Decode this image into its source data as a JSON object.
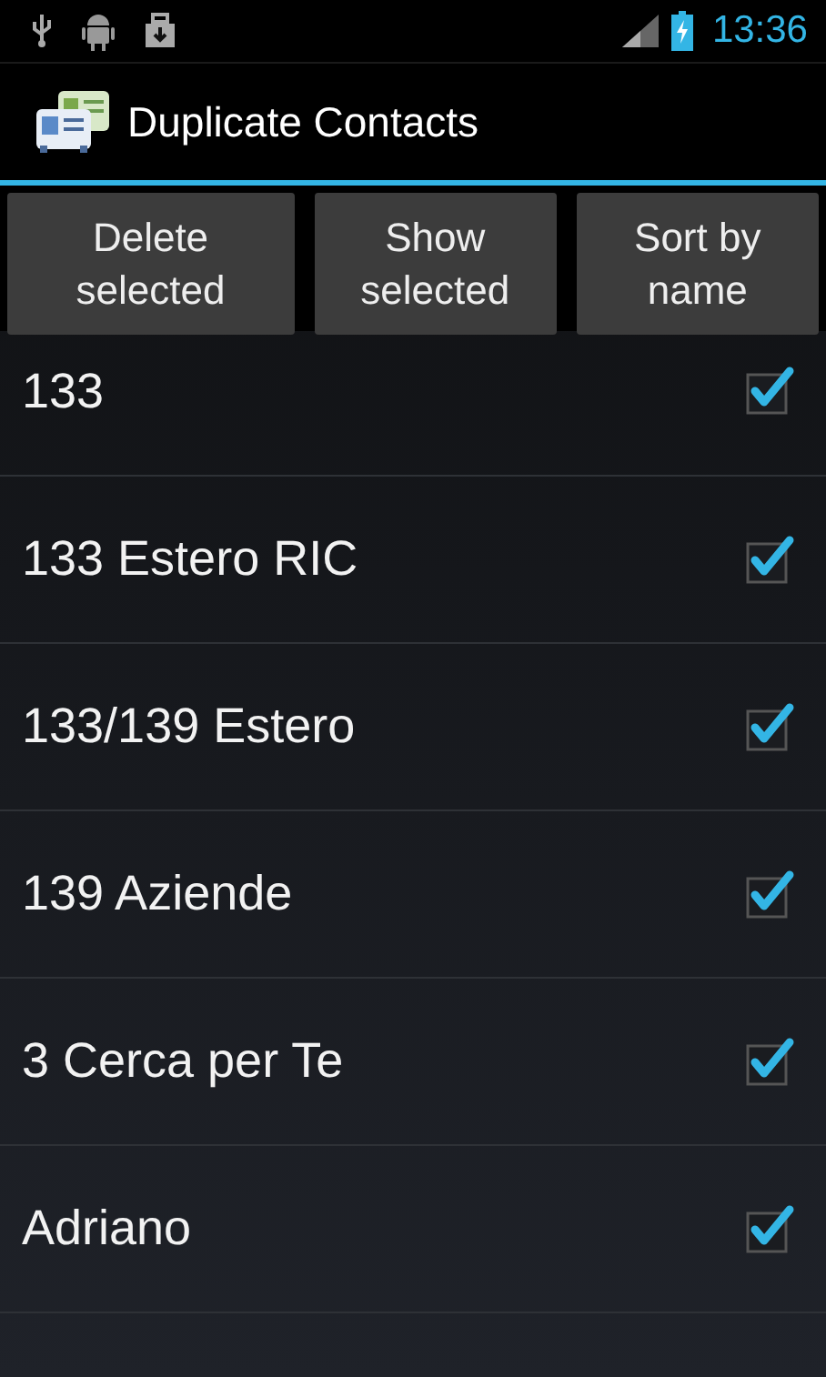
{
  "status_bar": {
    "time": "13:36"
  },
  "app_bar": {
    "title": "Duplicate Contacts"
  },
  "buttons": [
    {
      "label": "Delete selected"
    },
    {
      "label": "Show selected"
    },
    {
      "label": "Sort by name"
    }
  ],
  "contacts": [
    {
      "name": "133",
      "checked": true
    },
    {
      "name": "133 Estero RIC",
      "checked": true
    },
    {
      "name": "133/139 Estero",
      "checked": true
    },
    {
      "name": "139 Aziende",
      "checked": true
    },
    {
      "name": "3 Cerca per Te",
      "checked": true
    },
    {
      "name": "Adriano",
      "checked": true
    }
  ]
}
